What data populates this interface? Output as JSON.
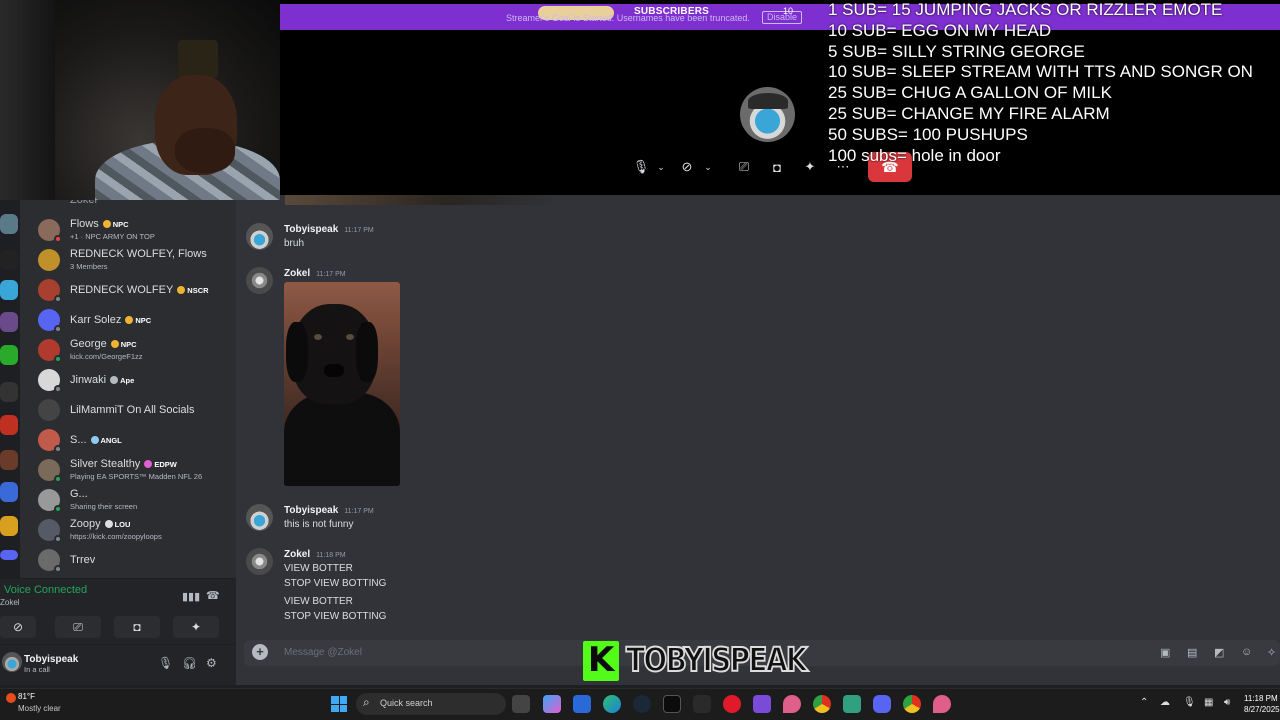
{
  "subscriber_banner": {
    "notice": "Streamer's Goal Is Started. Usernames have been truncated.",
    "title": "SUBSCRIBERS",
    "count": "10",
    "disable_label": "Disable"
  },
  "sub_goals": [
    "1 SUB= 15 JUMPING JACKS OR RIZZLER EMOTE",
    "10 SUB= EGG ON MY HEAD",
    "5 SUB= SILLY STRING GEORGE",
    "10 SUB= SLEEP STREAM WITH TTS AND SONGR ON",
    "25 SUB= CHUG A GALLON OF MILK",
    "25 SUB= CHANGE MY FIRE ALARM",
    "50 SUBS= 100 PUSHUPS",
    "100 subs= hole in door"
  ],
  "call_controls": {
    "mic_icon": "microphone-icon",
    "camera_icon": "camera-off-icon",
    "screen_icon": "screen-share-icon",
    "activity_icon": "controller-icon",
    "soundboard_icon": "soundboard-icon",
    "more_icon": "more-icon",
    "hangup_icon": "phone-hangup-icon"
  },
  "dm_list": {
    "partial_top": "Zokel",
    "items": [
      {
        "name": "Flows",
        "tag": "NPC",
        "tag_color": "#f0b232",
        "sub": "+1 · NPC ARMY ON TOP",
        "avatar": "#8a6a5a",
        "status": "#f23f43"
      },
      {
        "name": "REDNECK WOLFEY, Flows",
        "tag": "",
        "tag_color": "",
        "sub": "3 Members",
        "avatar": "#c0902a",
        "status": ""
      },
      {
        "name": "REDNECK WOLFEY",
        "tag": "NSCR",
        "tag_color": "#f0b232",
        "sub": "",
        "avatar": "#a84030",
        "status": "#80848e"
      },
      {
        "name": "Karr Solez",
        "tag": "NPC",
        "tag_color": "#f0b232",
        "sub": "",
        "avatar": "#5865f2",
        "status": "#80848e"
      },
      {
        "name": "George",
        "tag": "NPC",
        "tag_color": "#f0b232",
        "sub": "kick.com/GeorgeF1zz",
        "avatar": "#b03a2e",
        "status": "#23a55a"
      },
      {
        "name": "Jinwaki",
        "tag": "Ape",
        "tag_color": "#b5bac1",
        "sub": "",
        "avatar": "#d8d8d8",
        "status": "#80848e"
      },
      {
        "name": "LilMammiT On All Socials",
        "tag": "",
        "tag_color": "",
        "sub": "",
        "avatar": "#444",
        "status": ""
      },
      {
        "name": "S...",
        "tag": "ANGL",
        "tag_color": "#8ecbf2",
        "sub": "",
        "avatar": "#c05a4a",
        "status": "#80848e"
      },
      {
        "name": "Silver Stealthy",
        "tag": "EDPW",
        "tag_color": "#e05fd0",
        "sub": "Playing EA SPORTS™ Madden NFL 26",
        "avatar": "#7a6a5a",
        "status": "#23a55a"
      },
      {
        "name": "G...",
        "tag": "",
        "tag_color": "",
        "sub": "Sharing their screen",
        "avatar": "#999",
        "status": "#23a55a"
      },
      {
        "name": "Zoopy",
        "tag": "LOU",
        "tag_color": "#dbdee1",
        "sub": "https://kick.com/zoopyloops",
        "avatar": "#555a66",
        "status": "#80848e"
      },
      {
        "name": "Trrev",
        "tag": "",
        "tag_color": "",
        "sub": "",
        "avatar": "#6a6a6a",
        "status": "#80848e"
      }
    ]
  },
  "voice": {
    "status": "Voice Connected",
    "channel": "Zokel"
  },
  "user": {
    "name": "Tobyispeak",
    "status": "In a call"
  },
  "messages": [
    {
      "author": "Tobyispeak",
      "time": "11:17 PM",
      "lines": [
        "bruh"
      ]
    },
    {
      "author": "Zokel",
      "time": "11:17 PM",
      "lines": []
    },
    {
      "author": "Tobyispeak",
      "time": "11:17 PM",
      "lines": [
        "this is not funny"
      ]
    },
    {
      "author": "Zokel",
      "time": "11:18 PM",
      "lines": [
        "VIEW BOTTER",
        "STOP VIEW BOTTING",
        "VIEW BOTTER",
        "STOP VIEW BOTTING"
      ]
    }
  ],
  "composer": {
    "placeholder": "Message @Zokel"
  },
  "overlay": {
    "brand_letter": "K",
    "channel_name": "TOBYISPEAK"
  },
  "taskbar": {
    "temperature": "81°F",
    "weather": "Mostly clear",
    "search_placeholder": "Quick search",
    "time": "11:18 PM",
    "date": "8/27/2025"
  },
  "colors": {
    "accent_purple": "#7e2fd0",
    "online_green": "#23a55a",
    "hangup_red": "#da373c",
    "kick_green": "#53fc18"
  }
}
